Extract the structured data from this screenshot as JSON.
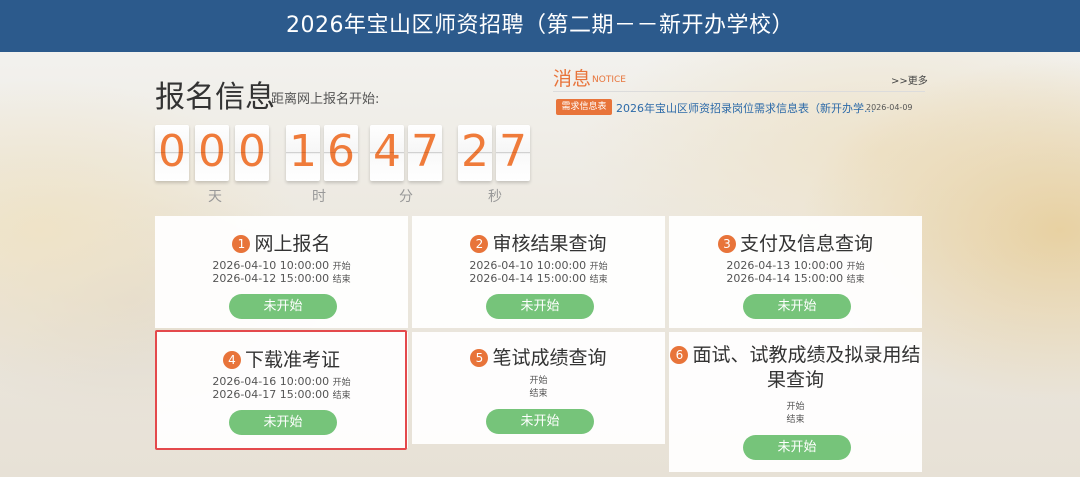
{
  "header": {
    "title": "2026年宝山区师资招聘（第二期－－新开办学校）"
  },
  "registration": {
    "title": "报名信息",
    "subtitle": "距离网上报名开始:",
    "countdown": {
      "digits": [
        "0",
        "0",
        "0",
        "1",
        "6",
        "4",
        "7",
        "2",
        "7"
      ],
      "units": [
        "天",
        "时",
        "分",
        "秒"
      ]
    }
  },
  "notice": {
    "title": "消息",
    "title_en": "NOTICE",
    "more": ">>更多",
    "items": [
      {
        "tag": "需求信息表",
        "text": "2026年宝山区师资招录岗位需求信息表（新开办学...",
        "date": "2026-04-09"
      }
    ]
  },
  "steps": [
    {
      "num": "1",
      "title": "网上报名",
      "start": "2026-04-10 10:00:00",
      "end": "2026-04-12 15:00:00",
      "start_label": "开始",
      "end_label": "结束",
      "button": "未开始"
    },
    {
      "num": "2",
      "title": "审核结果查询",
      "start": "2026-04-10 10:00:00",
      "end": "2026-04-14 15:00:00",
      "start_label": "开始",
      "end_label": "结束",
      "button": "未开始"
    },
    {
      "num": "3",
      "title": "支付及信息查询",
      "start": "2026-04-13 10:00:00",
      "end": "2026-04-14 15:00:00",
      "start_label": "开始",
      "end_label": "结束",
      "button": "未开始"
    },
    {
      "num": "4",
      "title": "下载准考证",
      "start": "2026-04-16 10:00:00",
      "end": "2026-04-17 15:00:00",
      "start_label": "开始",
      "end_label": "结束",
      "button": "未开始"
    },
    {
      "num": "5",
      "title": "笔试成绩查询",
      "start": "",
      "end": "",
      "start_label": "开始",
      "end_label": "结束",
      "button": "未开始"
    },
    {
      "num": "6",
      "title_line1": "面试、试教成绩及拟录用结",
      "title_line2": "果查询",
      "start": "",
      "end": "",
      "start_label": "开始",
      "end_label": "结束",
      "button": "未开始"
    }
  ],
  "colors": {
    "header_bg": "#2c5a8c",
    "accent": "#e8743a",
    "button": "#76c47a",
    "highlight": "#e4494c"
  }
}
